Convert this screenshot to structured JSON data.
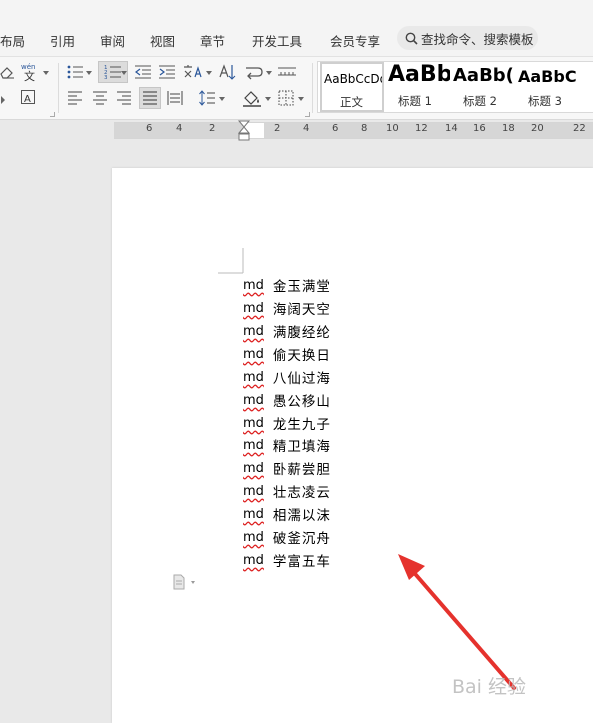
{
  "menu": {
    "items": [
      "布局",
      "引用",
      "审阅",
      "视图",
      "章节",
      "开发工具",
      "会员专享"
    ],
    "search_label": "查找命令、搜索模板"
  },
  "ribbon": {
    "styles": [
      {
        "sample": "AaBbCcDd",
        "name": "正文"
      },
      {
        "sample": "AaBb",
        "name": "标题 1"
      },
      {
        "sample": "AaBb(",
        "name": "标题 2"
      },
      {
        "sample": "AaBbC",
        "name": "标题 3"
      }
    ],
    "phonetic_label": "wén"
  },
  "ruler": {
    "numbers": [
      "6",
      "4",
      "2",
      "2",
      "4",
      "6",
      "8",
      "10",
      "12",
      "14",
      "16",
      "18",
      "20",
      "22"
    ]
  },
  "document": {
    "prefix": "md",
    "lines": [
      "金玉满堂",
      "海阔天空",
      "满腹经纶",
      "偷天换日",
      "八仙过海",
      "愚公移山",
      "龙生九子",
      "精卫填海",
      "卧薪尝胆",
      "壮志凌云",
      "相濡以沫",
      "破釜沉舟",
      "学富五车"
    ]
  },
  "watermark": "Bai 经验",
  "colors": {
    "arrow": "#e5322d",
    "spell_underline": "#d22222",
    "accent": "#2b579a"
  }
}
